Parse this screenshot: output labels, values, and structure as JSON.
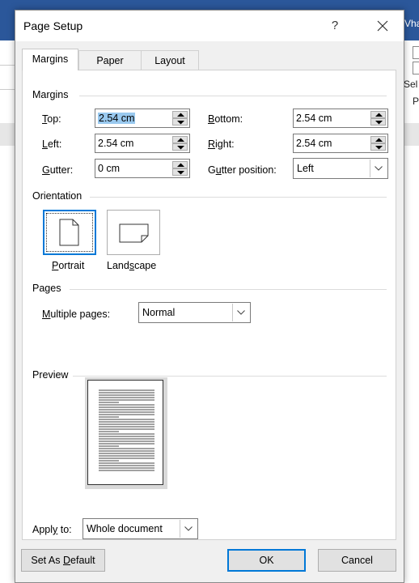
{
  "background": {
    "ribbon_partial_text": "Vha",
    "right_text_1": "Sel",
    "right_text_2": "P"
  },
  "dialog": {
    "title": "Page Setup",
    "help_label": "?",
    "tabs": [
      "Margins",
      "Paper",
      "Layout"
    ],
    "active_tab": "Margins"
  },
  "margins": {
    "group_label": "Margins",
    "top": {
      "label_u": "T",
      "label_rest": "op:",
      "value": "2.54 cm"
    },
    "bottom": {
      "label_u": "B",
      "label_rest": "ottom:",
      "value": "2.54 cm"
    },
    "left": {
      "label_u": "L",
      "label_rest": "eft:",
      "value": "2.54 cm"
    },
    "right": {
      "label_u": "R",
      "label_rest": "ight:",
      "value": "2.54 cm"
    },
    "gutter": {
      "label_u": "G",
      "label_rest": "utter:",
      "value": "0 cm"
    },
    "gutter_position": {
      "label_pre": "G",
      "label_u": "u",
      "label_rest": "tter position:",
      "value": "Left"
    }
  },
  "orientation": {
    "group_label": "Orientation",
    "portrait": {
      "label_u": "P",
      "label_rest": "ortrait"
    },
    "landscape": {
      "label_pre": "Land",
      "label_u": "s",
      "label_rest": "cape"
    },
    "selected": "Portrait"
  },
  "pages": {
    "group_label": "Pages",
    "multiple_pages_u": "M",
    "multiple_pages_rest": "ultiple pages:",
    "value": "Normal"
  },
  "preview": {
    "group_label": "Preview"
  },
  "apply_to": {
    "label_pre": "Appl",
    "label_u": "y",
    "label_rest": " to:",
    "value": "Whole document"
  },
  "buttons": {
    "set_default_pre": "Set As ",
    "set_default_u": "D",
    "set_default_rest": "efault",
    "ok": "OK",
    "cancel": "Cancel"
  },
  "colors": {
    "accent": "#0078d7",
    "selection": "#99c9ef",
    "word_ribbon": "#2b579a"
  }
}
